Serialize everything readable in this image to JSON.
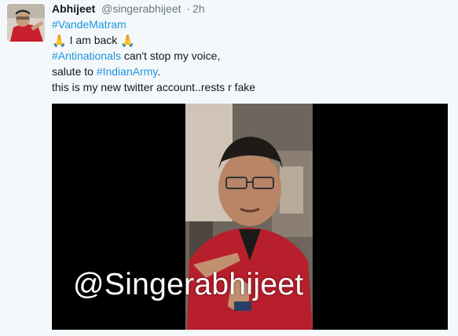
{
  "tweet": {
    "author": {
      "name": "Abhijeet",
      "handle": "@singerabhijeet",
      "avatar_icon": "profile-photo-icon"
    },
    "separator": "·",
    "time": "2h",
    "text": {
      "line1_hashtag": "#VandeMatram",
      "line2_emoji_left": "🙏",
      "line2_text": " I am back ",
      "line2_emoji_right": "🙏",
      "line3_hashtag": "#Antinationals",
      "line3_text": " can't stop my voice,",
      "line4_text": "salute to ",
      "line4_hashtag": "#IndianArmy",
      "line4_end": ".",
      "line5_text": "this is my new twitter account..rests r fake"
    },
    "media": {
      "watermark": "@Singerabhijeet"
    }
  },
  "colors": {
    "background": "#f5f8fa",
    "link": "#1b95e0",
    "muted": "#657786",
    "text": "#14171a"
  }
}
